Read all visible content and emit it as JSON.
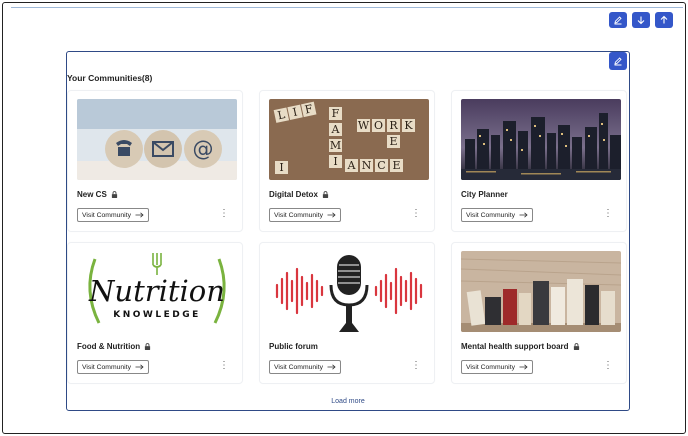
{
  "toolbar": {
    "edit_icon": "pencil-icon",
    "down_icon": "arrow-down-icon",
    "up_icon": "arrow-up-icon",
    "accent": "#3457c9"
  },
  "panel": {
    "title": "Your Communities(8)",
    "edit_icon": "pencil-icon",
    "load_more": "Load more"
  },
  "communities": [
    {
      "name": "New CS",
      "locked": true,
      "visit_label": "Visit Community",
      "image": "contact-icons"
    },
    {
      "name": "Digital Detox",
      "locked": true,
      "visit_label": "Visit Community",
      "image": "word-tiles"
    },
    {
      "name": "City Planner",
      "locked": false,
      "visit_label": "Visit Community",
      "image": "city-skyline"
    },
    {
      "name": "Food & Nutrition",
      "locked": true,
      "visit_label": "Visit Community",
      "image": "nutrition-knowledge-logo",
      "image_text": [
        "Nutrition",
        "KNOWLEDGE"
      ]
    },
    {
      "name": "Public forum",
      "locked": false,
      "visit_label": "Visit Community",
      "image": "microphone-soundwave"
    },
    {
      "name": "Mental health support board",
      "locked": true,
      "visit_label": "Visit Community",
      "image": "books"
    }
  ]
}
